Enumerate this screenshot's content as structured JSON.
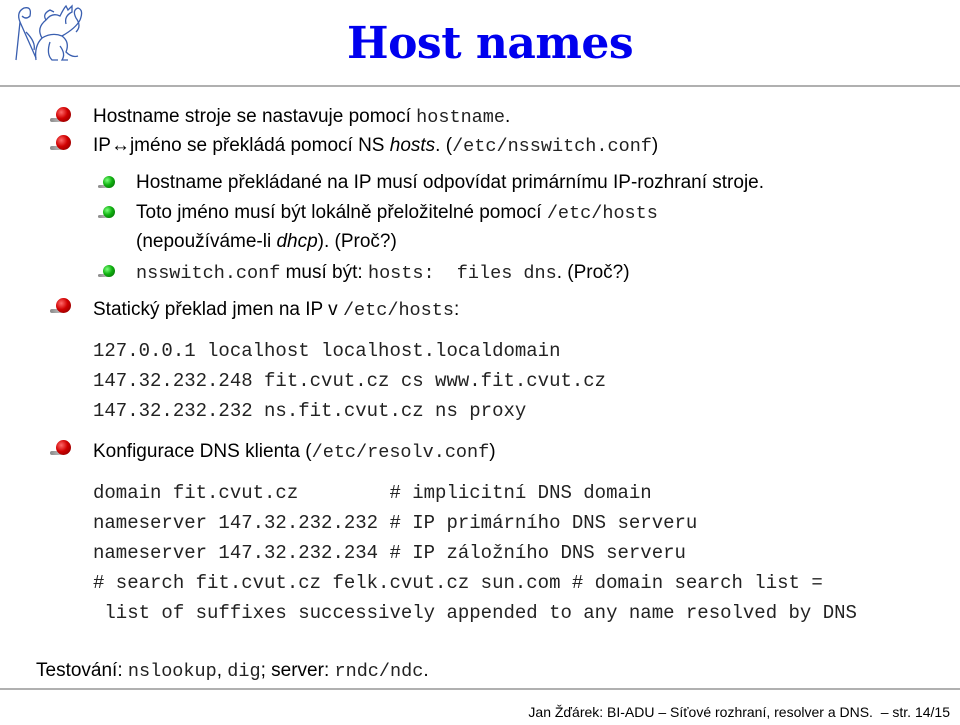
{
  "header": {
    "logo_icon": "ctu-lion-logo",
    "title": "Host names"
  },
  "bullets": {
    "b1": {
      "text": "Hostname stroje se nastavuje pomocí ",
      "code": "hostname",
      "tail": "."
    },
    "b2": {
      "pre": "IP",
      "arrow": "↔",
      "text": "jméno se překládá pomocí NS ",
      "italic": "hosts",
      "mid": ". (",
      "code": "/etc/nsswitch.conf",
      "tail": ")"
    },
    "b2_sub": [
      {
        "text": "Hostname překládané na IP musí odpovídat primárnímu IP-rozhraní stroje."
      },
      {
        "text": "Toto jméno musí být lokálně přeložitelné pomocí ",
        "code": "/etc/hosts",
        "cont_pre": "(nepoužíváme-li ",
        "cont_italic": "dhcp",
        "cont_tail": "). (Proč?)"
      },
      {
        "code1": "nsswitch.conf",
        "text": " musí být: ",
        "code2": "hosts:  files dns",
        "tail": ". (Proč?)"
      }
    ],
    "b3": {
      "text": "Statický překlad jmen na IP v ",
      "code": "/etc/hosts",
      "tail": ":"
    },
    "hosts_file": [
      "127.0.0.1 localhost localhost.localdomain",
      "147.32.232.248 fit.cvut.cz cs www.fit.cvut.cz",
      "147.32.232.232 ns.fit.cvut.cz ns proxy"
    ],
    "b4": {
      "text": "Konfigurace DNS klienta (",
      "code": "/etc/resolv.conf",
      "tail": ")"
    },
    "resolv_file": [
      "domain fit.cvut.cz        # implicitní DNS domain",
      "nameserver 147.32.232.232 # IP primárního DNS serveru",
      "nameserver 147.32.232.234 # IP záložního DNS serveru",
      "# search fit.cvut.cz felk.cvut.cz sun.com # domain search list =",
      " list of suffixes successively appended to any name resolved by DNS"
    ]
  },
  "testing": {
    "label": "Testování: ",
    "code1": "nslookup",
    "sep": ", ",
    "code2": "dig",
    "mid": "; server: ",
    "code3": "rndc/ndc",
    "tail": "."
  },
  "footer": {
    "text": "Jan Žďárek: BI-ADU – Síťové rozhraní, resolver a DNS.  – str. 14/15"
  },
  "colors": {
    "title": "#0000ee",
    "rule": "#b0b0b0",
    "bullet_main": "#d00000",
    "bullet_sub": "#10b010"
  }
}
